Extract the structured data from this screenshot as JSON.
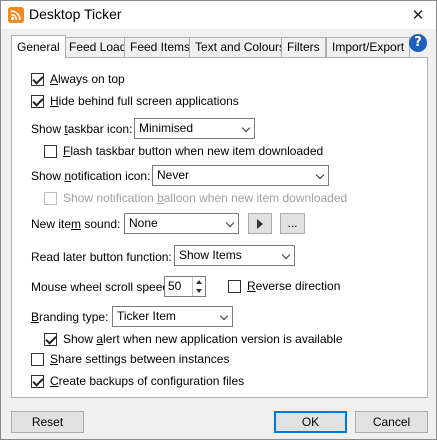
{
  "window": {
    "title": "Desktop Ticker",
    "close_glyph": "✕",
    "app_icon": "rss-icon"
  },
  "tabs": [
    {
      "label": "General",
      "active": true
    },
    {
      "label": "Feed Load",
      "active": false
    },
    {
      "label": "Feed Items",
      "active": false
    },
    {
      "label": "Text and Colours",
      "active": false
    },
    {
      "label": "Filters",
      "active": false
    },
    {
      "label": "Import/Export",
      "active": false
    }
  ],
  "help_glyph": "?",
  "general": {
    "always_on_top": {
      "pre": "",
      "key": "A",
      "post": "lways on top",
      "checked": true
    },
    "hide_fullscreen": {
      "pre": "",
      "key": "H",
      "post": "ide behind full screen applications",
      "checked": true
    },
    "taskbar_icon": {
      "pre": "Show ",
      "key": "t",
      "post": "askbar icon:",
      "value": "Minimised"
    },
    "flash_taskbar": {
      "pre": "",
      "key": "F",
      "post": "lash taskbar button when new item downloaded",
      "checked": false
    },
    "notification_icon": {
      "pre": "Show ",
      "key": "n",
      "post": "otification icon:",
      "value": "Never"
    },
    "notification_balloon": {
      "pre": "Show notification ",
      "key": "b",
      "post": "alloon when new item downloaded",
      "checked": false,
      "disabled": true
    },
    "new_item_sound": {
      "pre": "New ite",
      "key": "m",
      "post": " sound:",
      "value": "None",
      "browse_label": "..."
    },
    "read_later": {
      "label": "Read later button function:",
      "value": "Show Items"
    },
    "scroll_speed": {
      "label": "Mouse wheel scroll speed:",
      "value": "50"
    },
    "reverse_direction": {
      "pre": "",
      "key": "R",
      "post": "everse direction",
      "checked": false
    },
    "branding": {
      "pre": "",
      "key": "B",
      "post": "randing type:",
      "value": "Ticker Item"
    },
    "show_alert": {
      "pre": "Show ",
      "key": "a",
      "post": "lert when new application version is available",
      "checked": true
    },
    "share_settings": {
      "pre": "",
      "key": "S",
      "post": "hare settings between instances",
      "checked": false
    },
    "create_backups": {
      "pre": "",
      "key": "C",
      "post": "reate backups of configuration files",
      "checked": true
    }
  },
  "footer": {
    "reset": "Reset",
    "ok": "OK",
    "cancel": "Cancel"
  }
}
